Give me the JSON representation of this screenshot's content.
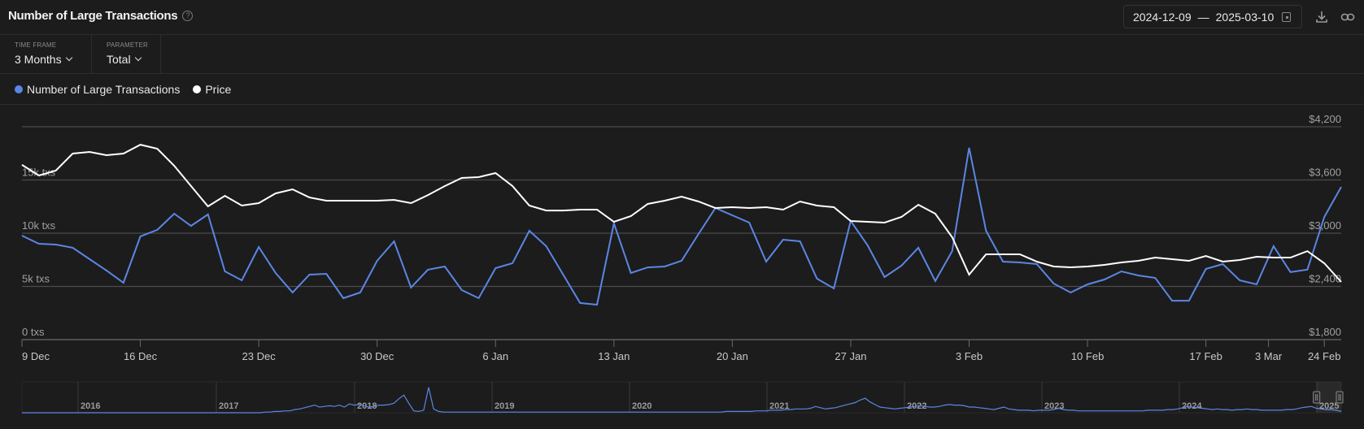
{
  "header": {
    "title": "Number of Large Transactions",
    "help_icon": "question-circle-icon",
    "date_from": "2024-12-09",
    "date_separator": "—",
    "date_to": "2025-03-10",
    "calendar_icon": "calendar-icon",
    "download_icon": "download-icon",
    "link_icon": "link-icon"
  },
  "filters": [
    {
      "label": "TIME FRAME",
      "value": "3 Months"
    },
    {
      "label": "PARAMETER",
      "value": "Total"
    }
  ],
  "legend": [
    {
      "label": "Number of Large Transactions",
      "color": "#5b86e5"
    },
    {
      "label": "Price",
      "color": "#ffffff"
    }
  ],
  "colors": {
    "background": "#1c1c1c",
    "grid": "#4a4a4a",
    "axis_text": "#a0a0a0",
    "transactions": "#5b86e5",
    "price": "#ffffff"
  },
  "chart_data": {
    "type": "line",
    "title": "Number of Large Transactions",
    "x_start": "2024-12-09",
    "x_step_days": 1,
    "x_tick_labels": [
      "9 Dec",
      "16 Dec",
      "23 Dec",
      "30 Dec",
      "6 Jan",
      "13 Jan",
      "20 Jan",
      "27 Jan",
      "3 Feb",
      "10 Feb",
      "17 Feb",
      "3 Mar",
      "24 Feb"
    ],
    "x_tick_index": [
      0,
      7,
      14,
      21,
      28,
      35,
      42,
      49,
      56,
      63,
      70,
      73.7,
      77
    ],
    "y_left": {
      "label": "",
      "ticks": [
        "0 txs",
        "5k txs",
        "10k txs",
        "15k txs"
      ],
      "tick_values": [
        0,
        5000,
        10000,
        15000
      ],
      "range": [
        0,
        20000
      ]
    },
    "y_right": {
      "label": "",
      "ticks": [
        "$1,800",
        "$2,400",
        "$3,000",
        "$3,600",
        "$4,200"
      ],
      "tick_values": [
        1800,
        2400,
        3000,
        3600,
        4200
      ],
      "range": [
        1800,
        4200
      ]
    },
    "grid": true,
    "legend_position": "top-left",
    "series": [
      {
        "name": "Number of Large Transactions",
        "axis": "left",
        "color": "#5b86e5",
        "values": [
          9770,
          9010,
          8930,
          8630,
          7560,
          6490,
          5340,
          9700,
          10310,
          11830,
          10690,
          11760,
          6410,
          5570,
          8700,
          6260,
          4430,
          6110,
          6180,
          3890,
          4430,
          7410,
          9240,
          4890,
          6570,
          6870,
          4660,
          3890,
          6720,
          7180,
          10230,
          8780,
          6110,
          3440,
          3280,
          10920,
          6260,
          6790,
          6870,
          7410,
          9920,
          12370,
          11680,
          10990,
          7330,
          9390,
          9240,
          5730,
          4810,
          11150,
          8860,
          5880,
          6950,
          8630,
          5500,
          8320,
          18020,
          10230,
          7330,
          7250,
          7100,
          5270,
          4430,
          5190,
          5650,
          6410,
          6030,
          5800,
          3660,
          3660,
          6640,
          7100,
          5570,
          5190,
          8780,
          6340,
          6570,
          11530,
          14350
        ]
      },
      {
        "name": "Price",
        "axis": "right",
        "color": "#ffffff",
        "values": [
          3770,
          3650,
          3705,
          3898,
          3916,
          3879,
          3898,
          3998,
          3953,
          3760,
          3531,
          3302,
          3421,
          3311,
          3339,
          3449,
          3495,
          3403,
          3366,
          3366,
          3366,
          3366,
          3376,
          3339,
          3430,
          3531,
          3623,
          3632,
          3678,
          3531,
          3311,
          3256,
          3256,
          3266,
          3266,
          3128,
          3192,
          3330,
          3366,
          3412,
          3357,
          3284,
          3293,
          3284,
          3293,
          3266,
          3357,
          3311,
          3293,
          3137,
          3128,
          3119,
          3183,
          3321,
          3220,
          2954,
          2533,
          2762,
          2762,
          2762,
          2679,
          2624,
          2615,
          2624,
          2643,
          2670,
          2689,
          2725,
          2707,
          2689,
          2743,
          2679,
          2698,
          2734,
          2725,
          2725,
          2798,
          2661,
          2450
        ]
      }
    ]
  },
  "navigator": {
    "year_labels": [
      "2016",
      "2017",
      "2018",
      "2019",
      "2020",
      "2021",
      "2022",
      "2023",
      "2024",
      "2025"
    ],
    "overview_values": [
      0,
      0,
      0,
      0,
      0,
      0,
      0,
      0,
      0,
      0,
      0,
      0,
      0,
      0,
      0,
      0,
      0,
      0,
      0,
      0,
      0,
      0,
      0,
      0,
      0,
      0,
      0,
      0,
      0,
      0,
      0,
      0,
      0,
      0,
      0,
      0,
      0,
      0,
      0,
      0,
      0,
      0,
      0,
      0,
      0,
      0,
      0,
      0,
      0,
      1,
      1,
      2,
      2,
      3,
      3,
      5,
      6,
      8,
      10,
      12,
      9,
      10,
      11,
      10,
      12,
      9,
      14,
      12,
      13,
      11,
      9,
      10,
      12,
      12,
      13,
      15,
      22,
      28,
      15,
      3,
      2,
      4,
      40,
      6,
      2,
      1,
      1,
      1,
      1,
      1,
      1,
      1,
      1,
      1,
      1,
      1,
      1,
      1,
      1,
      1,
      1,
      1,
      1,
      1,
      1,
      1,
      1,
      1,
      1,
      1,
      1,
      1,
      1,
      1,
      1,
      1,
      1,
      1,
      1,
      1,
      1,
      1,
      1,
      1,
      1,
      1,
      1,
      1,
      1,
      1,
      1,
      1,
      1,
      1,
      1,
      1,
      1,
      1,
      1,
      1,
      1,
      1,
      2,
      2,
      2,
      2,
      2,
      2,
      3,
      3,
      3,
      4,
      4,
      4,
      5,
      5,
      6,
      6,
      6,
      7,
      10,
      8,
      6,
      7,
      8,
      10,
      12,
      14,
      16,
      20,
      23,
      17,
      13,
      9,
      8,
      7,
      6,
      7,
      8,
      9,
      10,
      11,
      10,
      9,
      9,
      10,
      12,
      13,
      12,
      12,
      11,
      9,
      9,
      8,
      7,
      6,
      5,
      7,
      9,
      6,
      5,
      4,
      4,
      4,
      3,
      4,
      4,
      4,
      5,
      7,
      5,
      4,
      4,
      3,
      3,
      3,
      3,
      3,
      3,
      3,
      3,
      3,
      3,
      3,
      3,
      3,
      3,
      4,
      4,
      4,
      4,
      5,
      5,
      6,
      8,
      10,
      9,
      8,
      7,
      6,
      5,
      6,
      5,
      5,
      4,
      5,
      5,
      6,
      5,
      5,
      4,
      4,
      4,
      4,
      4,
      5,
      5,
      6,
      8,
      9,
      10,
      7,
      6,
      5,
      5,
      4,
      2
    ],
    "selected_range_fraction": [
      0.985,
      1.0
    ]
  }
}
